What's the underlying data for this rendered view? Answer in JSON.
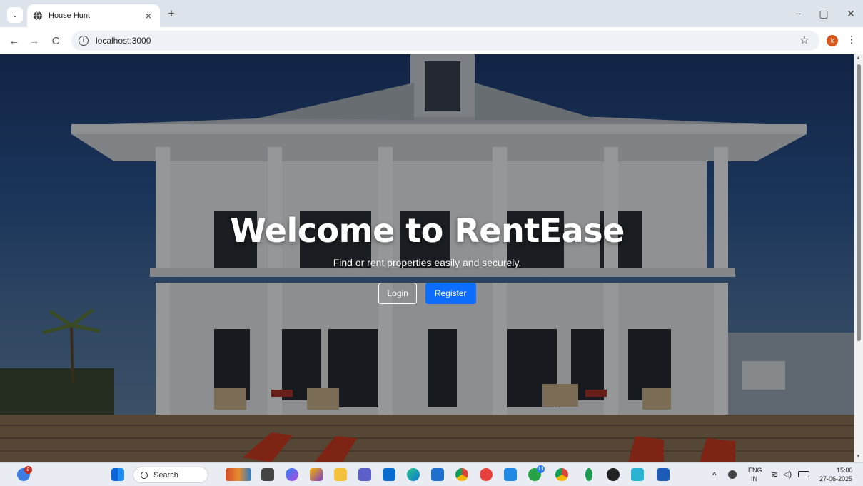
{
  "browser": {
    "tab_title": "House Hunt",
    "tab_close": "×",
    "new_tab": "+",
    "url": "localhost:3000",
    "profile_initial": "k",
    "win_min": "−",
    "win_max": "▢",
    "win_close": "✕",
    "back": "←",
    "forward": "→",
    "reload": "C",
    "info": "i",
    "star": "☆",
    "menu": "⋮",
    "tab_search": "⌄"
  },
  "hero": {
    "title": "Welcome to RentEase",
    "subtitle": "Find or rent properties easily and securely.",
    "login_label": "Login",
    "register_label": "Register"
  },
  "taskbar": {
    "search_label": "Search",
    "weather_badge": "9",
    "whatsapp_badge": "13",
    "lang_top": "ENG",
    "lang_bottom": "IN",
    "time": "15:00",
    "date": "27-06-2025",
    "chevron": "^",
    "icons": [
      "weather-icon",
      "windows-start-icon",
      "search-icon",
      "people-icon",
      "file-explorer-icon",
      "copilot-icon",
      "paint-icon",
      "folder-icon",
      "teams-icon",
      "outlook-icon",
      "edge-icon",
      "store-icon",
      "chrome-icon",
      "wps-icon",
      "vscode-icon",
      "whatsapp-icon",
      "chrome-profile-icon",
      "mongodb-icon",
      "media-player-icon",
      "git-icon",
      "word-icon"
    ]
  }
}
